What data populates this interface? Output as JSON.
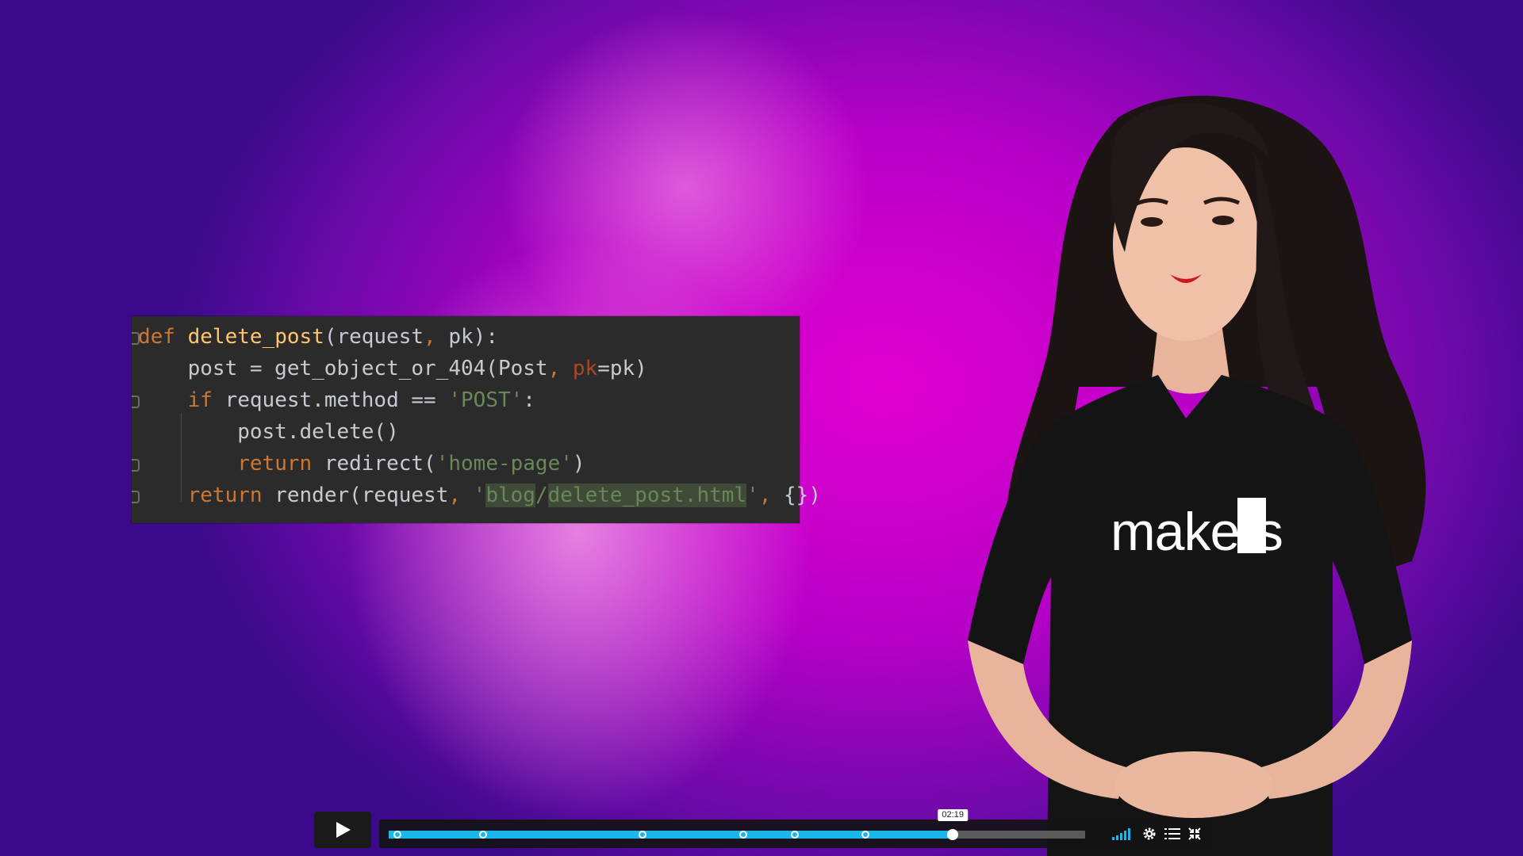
{
  "video": {
    "code_snippet": {
      "lines": [
        [
          {
            "t": "def ",
            "c": "kw"
          },
          {
            "t": "delete_post",
            "c": "fn"
          },
          {
            "t": "(request",
            "c": ""
          },
          {
            "t": ", ",
            "c": "kw"
          },
          {
            "t": "pk):",
            "c": ""
          }
        ],
        [
          {
            "t": "    post = get_object_or_404(Post",
            "c": ""
          },
          {
            "t": ", ",
            "c": "kw"
          },
          {
            "t": "pk",
            "c": "param"
          },
          {
            "t": "=pk)",
            "c": ""
          }
        ],
        [
          {
            "t": "    ",
            "c": ""
          },
          {
            "t": "if ",
            "c": "kw"
          },
          {
            "t": "request.method == ",
            "c": ""
          },
          {
            "t": "'POST'",
            "c": "str"
          },
          {
            "t": ":",
            "c": ""
          }
        ],
        [
          {
            "t": "        post.delete()",
            "c": ""
          }
        ],
        [
          {
            "t": "        ",
            "c": ""
          },
          {
            "t": "return ",
            "c": "kw"
          },
          {
            "t": "redirect(",
            "c": ""
          },
          {
            "t": "'home-page'",
            "c": "str"
          },
          {
            "t": ")",
            "c": ""
          }
        ],
        [
          {
            "t": "    ",
            "c": ""
          },
          {
            "t": "return ",
            "c": "kw"
          },
          {
            "t": "render(request",
            "c": ""
          },
          {
            "t": ", ",
            "c": "kw"
          },
          {
            "t": "'",
            "c": "str"
          },
          {
            "t": "blog",
            "c": "hl"
          },
          {
            "t": "/",
            "c": "str"
          },
          {
            "t": "delete_post.html",
            "c": "hl"
          },
          {
            "t": "'",
            "c": "str"
          },
          {
            "t": ", ",
            "c": "kw"
          },
          {
            "t": "{})",
            "c": ""
          }
        ]
      ]
    },
    "shirt_logo": "makers"
  },
  "player": {
    "play_icon": "play-icon",
    "progress": 0.81,
    "current_time_tooltip": "02:19",
    "chapter_markers": [
      0.012,
      0.135,
      0.364,
      0.509,
      0.583,
      0.684
    ],
    "volume_icon": "volume-icon",
    "volume_level": 1.0,
    "settings_icon": "gear-icon",
    "chapters_icon": "list-icon",
    "fullscreen_icon": "collapse-icon",
    "colors": {
      "accent": "#1ab7ea",
      "bar_bg": "#141414"
    }
  }
}
